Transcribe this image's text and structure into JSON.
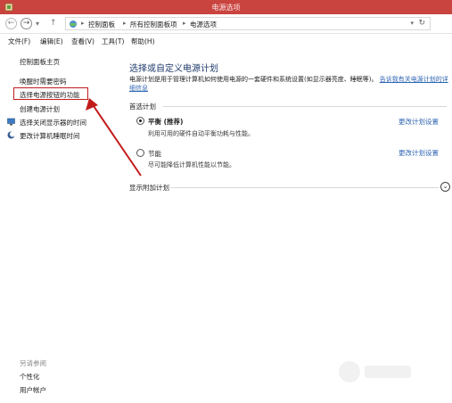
{
  "window": {
    "title": "电源选项"
  },
  "address": {
    "crumbs": [
      "控制面板",
      "所有控制面板项",
      "电源选项"
    ]
  },
  "menu": [
    "文件(F)",
    "编辑(E)",
    "查看(V)",
    "工具(T)",
    "帮助(H)"
  ],
  "sidebar": {
    "home": "控制面板主页",
    "links": [
      "唤醒时需要密码",
      "选择电源按钮的功能",
      "创建电源计划",
      "选择关闭显示器的时间",
      "更改计算机睡眠时间"
    ],
    "see_also_title": "另请参阅",
    "see_also": [
      "个性化",
      "用户帐户"
    ]
  },
  "main": {
    "title": "选择或自定义电源计划",
    "description": "电源计划是用于管理计算机如何使用电源的一套硬件和系统设置(如显示器亮度、睡眠等)。",
    "description_link": "告诉我有关电源计划的详细信息",
    "preferred_label": "首选计划",
    "plans": [
      {
        "name": "平衡 (推荐)",
        "desc": "利用可用的硬件自动平衡功耗与性能。",
        "link": "更改计划设置",
        "checked": true
      },
      {
        "name": "节能",
        "desc": "尽可能降低计算机性能以节能。",
        "link": "更改计划设置",
        "checked": false
      }
    ],
    "more_label": "显示附加计划"
  },
  "colors": {
    "titlebar": "#c9433f",
    "link": "#2f66b3",
    "highlight": "#c21b1b"
  }
}
